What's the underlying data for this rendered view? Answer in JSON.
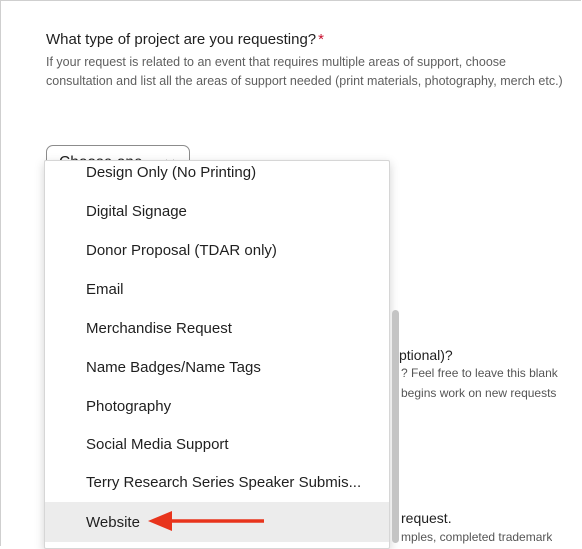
{
  "question": {
    "label": "What type of project are you requesting?",
    "required_marker": "*",
    "helper": "If your request is related to an event that requires multiple areas of support, choose consultation and list all the areas of support needed (print materials, photography, merch etc.)"
  },
  "select": {
    "value": "Choose one...",
    "icon": "chevron-down-icon"
  },
  "dropdown": {
    "options": [
      "Design Only (No Printing)",
      "Digital Signage",
      "Donor Proposal (TDAR only)",
      "Email",
      "Merchandise Request",
      "Name Badges/Name Tags",
      "Photography",
      "Social Media Support",
      "Terry Research Series Speaker Submis...",
      "Website"
    ],
    "selected": "Website"
  },
  "background": {
    "q2": "ptional)?",
    "h2a": "? Feel free to leave this blank",
    "h2b": "begins work on new requests",
    "q3": "request.",
    "h3": "mples, completed trademark"
  },
  "colors": {
    "required": "#c8102e",
    "arrow": "#e8341c",
    "selected_bg": "#ececec"
  }
}
